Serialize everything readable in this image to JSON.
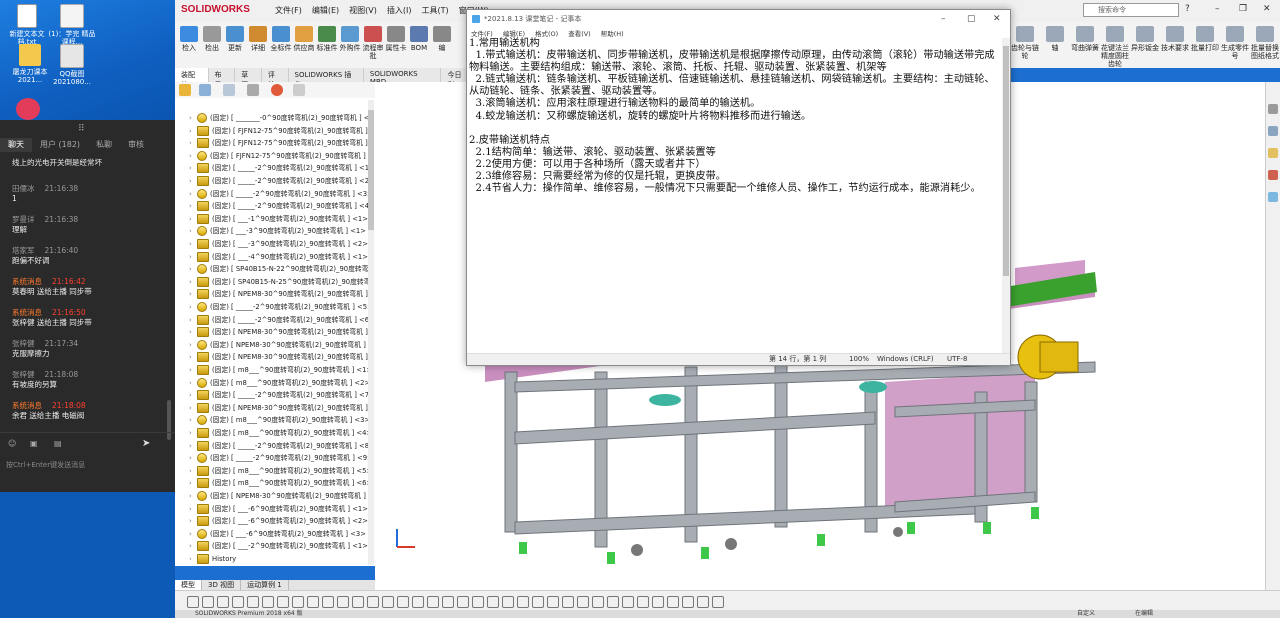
{
  "desktop": {
    "icons": [
      {
        "label": "新建文本文\n档.txt"
      },
      {
        "label": "(1)：学完\n精品课程..."
      },
      {
        "label": "屠龙刀课本\n2021..."
      },
      {
        "label": "QQ截图\n2021080..."
      }
    ]
  },
  "chat": {
    "tabs": [
      "聊天",
      "用户 (182)",
      "私聊",
      "审核"
    ],
    "messages": [
      {
        "name": "",
        "time": "",
        "text": "线上的光电开关倒是经常坏",
        "sys": false
      },
      {
        "name": "田儒冰",
        "time": "21:16:38",
        "text": "1",
        "sys": false
      },
      {
        "name": "罗曼详",
        "time": "21:16:38",
        "text": "理解",
        "sys": false
      },
      {
        "name": "塔家军",
        "time": "21:16:40",
        "text": "跑偏不好调",
        "sys": false
      },
      {
        "name": "系统消息",
        "time": "21:16:42",
        "text": "莫春明 送给主播 同步带",
        "sys": true
      },
      {
        "name": "系统消息",
        "time": "21:16:50",
        "text": "张梓健 送给主播 同步带",
        "sys": true
      },
      {
        "name": "张梓健",
        "time": "21:17:34",
        "text": "克服摩擦力",
        "sys": false
      },
      {
        "name": "张梓健",
        "time": "21:18:08",
        "text": "有坡度的另算",
        "sys": false
      },
      {
        "name": "系统消息",
        "time": "21:18:08",
        "text": "余君 送给主播 电磁阀",
        "sys": true
      }
    ],
    "input_hint": "按Ctrl+Enter键发送消息"
  },
  "solidworks": {
    "logo": "SOLIDWORKS",
    "menu": [
      "文件(F)",
      "编辑(E)",
      "视图(V)",
      "插入(I)",
      "工具(T)",
      "窗口(W)"
    ],
    "search_placeholder": "搜索命令",
    "ribbon_left": [
      "检入",
      "检出",
      "更新",
      "详细",
      "全标件",
      "供应商",
      "标准件",
      "外购件",
      "流程审批",
      "属性卡",
      "BOM",
      "编"
    ],
    "ribbon_right": [
      "齿轮与链轮",
      "轴",
      "弯曲弹簧",
      "花键法兰精度圆柱齿轮",
      "异形钣金",
      "技术要求",
      "批量打印",
      "生成零件号",
      "批量替换图纸格式"
    ],
    "tabs": [
      "装配体",
      "布局",
      "草图",
      "评估",
      "SOLIDWORKS 插件",
      "SOLIDWORKS MBD",
      "今日利"
    ],
    "tree_rows": [
      "(固定) [ _______-0^90度转弯机(2)_90度转弯机 ] <",
      "(固定) [ FJFN12-75^90度转弯机(2)_90度转弯机 ]",
      "(固定) [ FJFN12-75^90度转弯机(2)_90度转弯机 ]",
      "(固定) [ FJFN12-75^90度转弯机(2)_90度转弯机 ]",
      "(固定) [ _____-2^90度转弯机(2)_90度转弯机 ] <1>",
      "(固定) [ _____-2^90度转弯机(2)_90度转弯机 ] <2>",
      "(固定) [ _____-2^90度转弯机(2)_90度转弯机 ] <3>",
      "(固定) [ _____-2^90度转弯机(2)_90度转弯机 ] <4>",
      "(固定) [ ___-1^90度转弯机(2)_90度转弯机 ] <1>",
      "(固定) [ ___-3^90度转弯机(2)_90度转弯机 ] <1>",
      "(固定) [ ___-3^90度转弯机(2)_90度转弯机 ] <2>",
      "(固定) [ ___-4^90度转弯机(2)_90度转弯机 ] <1>",
      "(固定) [ SP40B15-N-22^90度转弯机(2)_90度转弯",
      "(固定) [ SP40B15-N-25^90度转弯机(2)_90度转弯",
      "(固定) [ NPEM8-30^90度转弯机(2)_90度转弯机 ]",
      "(固定) [ _____-2^90度转弯机(2)_90度转弯机 ] <5>",
      "(固定) [ _____-2^90度转弯机(2)_90度转弯机 ] <6>",
      "(固定) [ NPEM8-30^90度转弯机(2)_90度转弯机 ]",
      "(固定) [ NPEM8-30^90度转弯机(2)_90度转弯机 ]",
      "(固定) [ NPEM8-30^90度转弯机(2)_90度转弯机 ]",
      "(固定) [ m8___^90度转弯机(2)_90度转弯机 ] <1>",
      "(固定) [ m8___^90度转弯机(2)_90度转弯机 ] <2>",
      "(固定) [ _____-2^90度转弯机(2)_90度转弯机 ] <7>",
      "(固定) [ NPEM8-30^90度转弯机(2)_90度转弯机 ]",
      "(固定) [ m8___^90度转弯机(2)_90度转弯机 ] <3>",
      "(固定) [ m8___^90度转弯机(2)_90度转弯机 ] <4>",
      "(固定) [ _____-2^90度转弯机(2)_90度转弯机 ] <8>",
      "(固定) [ _____-2^90度转弯机(2)_90度转弯机 ] <9>",
      "(固定) [ m8___^90度转弯机(2)_90度转弯机 ] <5>",
      "(固定) [ m8___^90度转弯机(2)_90度转弯机 ] <6>",
      "(固定) [ NPEM8-30^90度转弯机(2)_90度转弯机 ]",
      "(固定) [ ___-6^90度转弯机(2)_90度转弯机 ] <1>",
      "(固定) [ ___-6^90度转弯机(2)_90度转弯机 ] <2>",
      "(固定) [ ___-6^90度转弯机(2)_90度转弯机 ] <3>",
      "(固定) [ ___-2^90度转弯机(2)_90度转弯机 ] <1>",
      "History"
    ],
    "bottom_tabs": [
      "模型",
      "3D 视图",
      "运动算例 1"
    ],
    "status_left": "SOLIDWORKS Premium 2018 x64 版",
    "status_right": [
      "自定义",
      "在编辑"
    ]
  },
  "notepad": {
    "title": "*2021.8.13 课堂笔记 - 记事本",
    "menu": [
      "文件(F)",
      "编辑(E)",
      "格式(O)",
      "查看(V)",
      "帮助(H)"
    ],
    "content": "1.常用输送机构\n  1.带式输送机：皮带输送机、同步带输送机，皮带输送机是根据摩擦传动原理，由传动滚筒（滚轮）带动输送带完成物料输送。主要结构组成：输送带、滚轮、滚筒、托板、托辊、驱动装置、张紧装置、机架等\n  2.链式输送机：链条输送机、平板链输送机、倍速链输送机、悬挂链输送机、网袋链输送机。主要结构：主动链轮、从动链轮、链条、张紧装置、驱动装置等。\n  3.滚筒输送机：应用滚柱原理进行输送物料的最简单的输送机。\n  4.蛟龙输送机：又称螺旋输送机，旋转的螺旋叶片将物料推移而进行输送。\n\n2.皮带输送机特点\n  2.1结构简单：输送带、滚轮、驱动装置、张紧装置等\n  2.2使用方便：可以用于各种场所（露天或者井下）\n  2.3维修容易：只需要经常为修的仅是托辊，更换皮带。\n  2.4节省人力：操作简单、维修容易，一般情况下只需要配一个维修人员、操作工，节约运行成本，能源消耗少。",
    "status": {
      "pos": "第 14 行，第 1 列",
      "zoom": "100%",
      "eol": "Windows (CRLF)",
      "enc": "UTF-8"
    }
  },
  "colors": {
    "sw_red": "#c8102e",
    "frame_gray": "#a7adb3",
    "panel_pink": "#c98fbf",
    "green_roller": "#3aa02e",
    "motor_yellow": "#e8c010",
    "foot_green": "#3ec84a"
  }
}
